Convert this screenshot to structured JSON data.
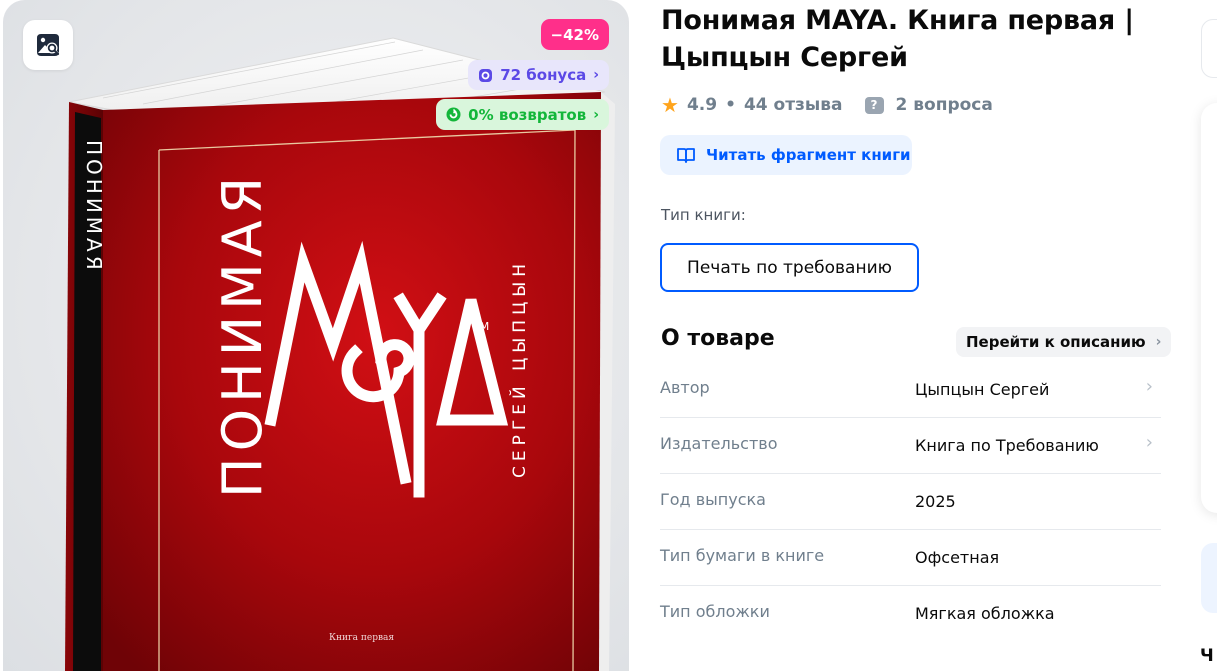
{
  "gallery": {
    "discount_badge": "−42%",
    "bonus_badge": "72 бонуса",
    "returns_badge": "0% возвратов",
    "book_cover": {
      "title": "ПОНИМАЯ",
      "logo": "MAYA",
      "trademark": "TM",
      "author": "СЕРГЕЙ ЦЫПЦЫН",
      "spine_title": "ПОНИМАЯ",
      "subtitle": "Книга первая",
      "cover_color": "#b3080d"
    }
  },
  "product": {
    "title": "Понимая MAYA. Книга первая | Цыпцын Сергей",
    "rating": "4.9",
    "reviews": "44 отзыва",
    "questions": "2 вопроса",
    "read_fragment": "Читать фрагмент книги",
    "book_type_label": "Тип книги:",
    "book_type_value": "Печать по требованию"
  },
  "about": {
    "title": "О товаре",
    "goto_description": "Перейти к описанию",
    "specs": [
      {
        "key": "Автор",
        "value": "Цыпцын Сергей",
        "link": true
      },
      {
        "key": "Издательство",
        "value": "Книга по Требованию",
        "link": true
      },
      {
        "key": "Год выпуска",
        "value": "2025",
        "link": false
      },
      {
        "key": "Тип бумаги в книге",
        "value": "Офсетная",
        "link": false
      },
      {
        "key": "Тип обложки",
        "value": "Мягкая обложка",
        "link": false
      }
    ]
  },
  "right_column": {
    "partial_text": "Ч"
  },
  "colors": {
    "accent": "#005bff",
    "discount": "#ff2f8a",
    "bonus": "#5b49e6",
    "returns": "#13b63a",
    "star": "#ffa41c"
  }
}
